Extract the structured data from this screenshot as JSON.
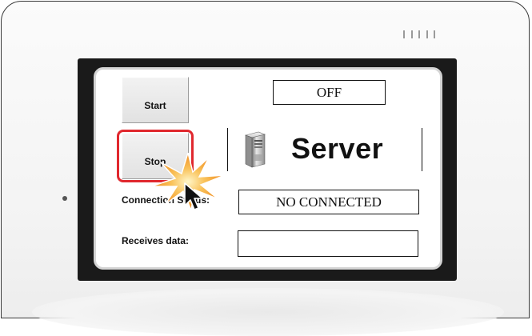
{
  "controls": {
    "start_label": "Start",
    "stop_label": "Stop"
  },
  "status": {
    "server_state": "OFF"
  },
  "server": {
    "title": "Server",
    "icon": "server-tower-icon"
  },
  "fields": {
    "connection_label": "Connection Status:",
    "connection_value": "NO CONNECTED",
    "receives_label": "Receives data:",
    "receives_value": ""
  },
  "overlay": {
    "highlight_color": "#e0282e",
    "click_burst_color": "#f5a623",
    "cursor": "mouse-pointer-icon"
  }
}
